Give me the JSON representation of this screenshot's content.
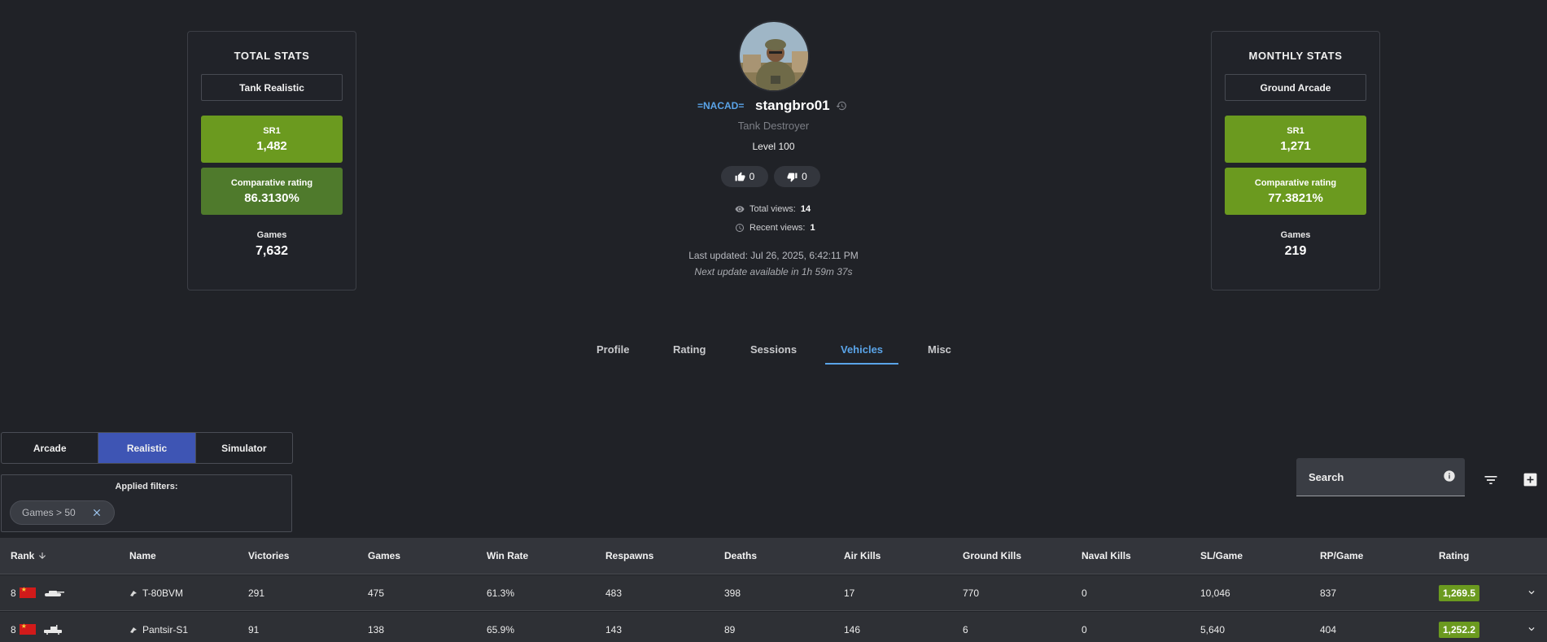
{
  "total_stats": {
    "title": "TOTAL STATS",
    "mode": "Tank Realistic",
    "sr_label": "SR1",
    "sr_value": "1,482",
    "cr_label": "Comparative rating",
    "cr_value": "86.3130%",
    "games_label": "Games",
    "games_value": "7,632"
  },
  "monthly_stats": {
    "title": "MONTHLY STATS",
    "mode": "Ground Arcade",
    "sr_label": "SR1",
    "sr_value": "1,271",
    "cr_label": "Comparative rating",
    "cr_value": "77.3821%",
    "games_label": "Games",
    "games_value": "219"
  },
  "profile": {
    "clan": "=NACAD=",
    "name": "stangbro01",
    "title": "Tank Destroyer",
    "level": "Level 100",
    "likes": "0",
    "dislikes": "0",
    "total_views_label": "Total views:",
    "total_views": "14",
    "recent_views_label": "Recent views:",
    "recent_views": "1",
    "last_updated": "Last updated: Jul 26, 2025, 6:42:11 PM",
    "next_update": "Next update available in 1h 59m 37s"
  },
  "tabs": [
    {
      "label": "Profile"
    },
    {
      "label": "Rating"
    },
    {
      "label": "Sessions"
    },
    {
      "label": "Vehicles",
      "active": true
    },
    {
      "label": "Misc"
    }
  ],
  "modes": [
    "Arcade",
    "Realistic",
    "Simulator"
  ],
  "active_mode": "Realistic",
  "filters": {
    "title": "Applied filters:",
    "chips": [
      "Games > 50"
    ]
  },
  "search": {
    "label": "Search"
  },
  "table": {
    "columns": [
      "Rank",
      "Name",
      "Victories",
      "Games",
      "Win Rate",
      "Respawns",
      "Deaths",
      "Air Kills",
      "Ground Kills",
      "Naval Kills",
      "SL/Game",
      "RP/Game",
      "Rating"
    ],
    "rows": [
      {
        "rank": "8",
        "name": "T-80BVM",
        "victories": "291",
        "games": "475",
        "win_rate": "61.3%",
        "respawns": "483",
        "deaths": "398",
        "air_kills": "17",
        "ground_kills": "770",
        "naval_kills": "0",
        "sl_game": "10,046",
        "rp_game": "837",
        "rating": "1,269.5"
      },
      {
        "rank": "8",
        "name": "Pantsir-S1",
        "victories": "91",
        "games": "138",
        "win_rate": "65.9%",
        "respawns": "143",
        "deaths": "89",
        "air_kills": "146",
        "ground_kills": "6",
        "naval_kills": "0",
        "sl_game": "5,640",
        "rp_game": "404",
        "rating": "1,252.2"
      }
    ]
  },
  "colors": {
    "background": "#202227",
    "accent": "#5aa4e8",
    "green": "#6b9a1f",
    "active_mode": "#3e55b4"
  }
}
